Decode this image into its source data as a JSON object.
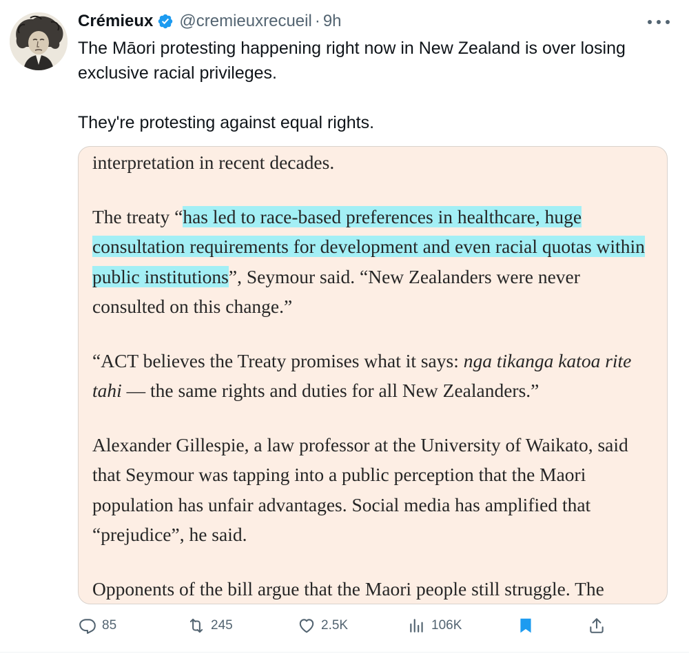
{
  "tweet": {
    "author_name": "Crémieux",
    "handle": "@cremieuxrecueil",
    "separator": "·",
    "time": "9h",
    "text_paragraphs": [
      "The Māori protesting happening right now in New Zealand is over losing exclusive racial privileges.",
      "They're protesting against equal rights."
    ]
  },
  "article": {
    "p1": "interpretation in recent decades.",
    "p2_before": "The treaty “",
    "p2_highlight": "has led to race-based preferences in healthcare, huge consultation requirements for development and even racial quotas within public institutions",
    "p2_after": "”, Seymour said. “New Zealanders were never consulted on this change.”",
    "p3_before": "“ACT believes the Treaty promises what it says: ",
    "p3_italic": "nga tikanga katoa rite tahi",
    "p3_after": " — the same rights and duties for all New Zealanders.”",
    "p4": "Alexander Gillespie, a law professor at the University of Waikato, said that Seymour was tapping into a public perception that the Maori population has unfair advantages. Social media has amplified that “prejudice”, he said.",
    "p5": "Opponents of the bill argue that the Maori people still struggle. The"
  },
  "actions": {
    "replies": "85",
    "reposts": "245",
    "likes": "2.5K",
    "views": "106K"
  },
  "icons": {
    "verified": "verified-badge-icon",
    "more": "more-options-icon",
    "reply": "reply-icon",
    "repost": "repost-icon",
    "like": "heart-icon",
    "views": "analytics-icon",
    "bookmark": "bookmark-icon",
    "share": "share-icon"
  },
  "colors": {
    "verified": "#1d9bf0",
    "secondary_text": "#536471",
    "bookmark_active": "#1d9bf0",
    "highlight": "#a3eff5",
    "card_background": "#fdeee4"
  }
}
